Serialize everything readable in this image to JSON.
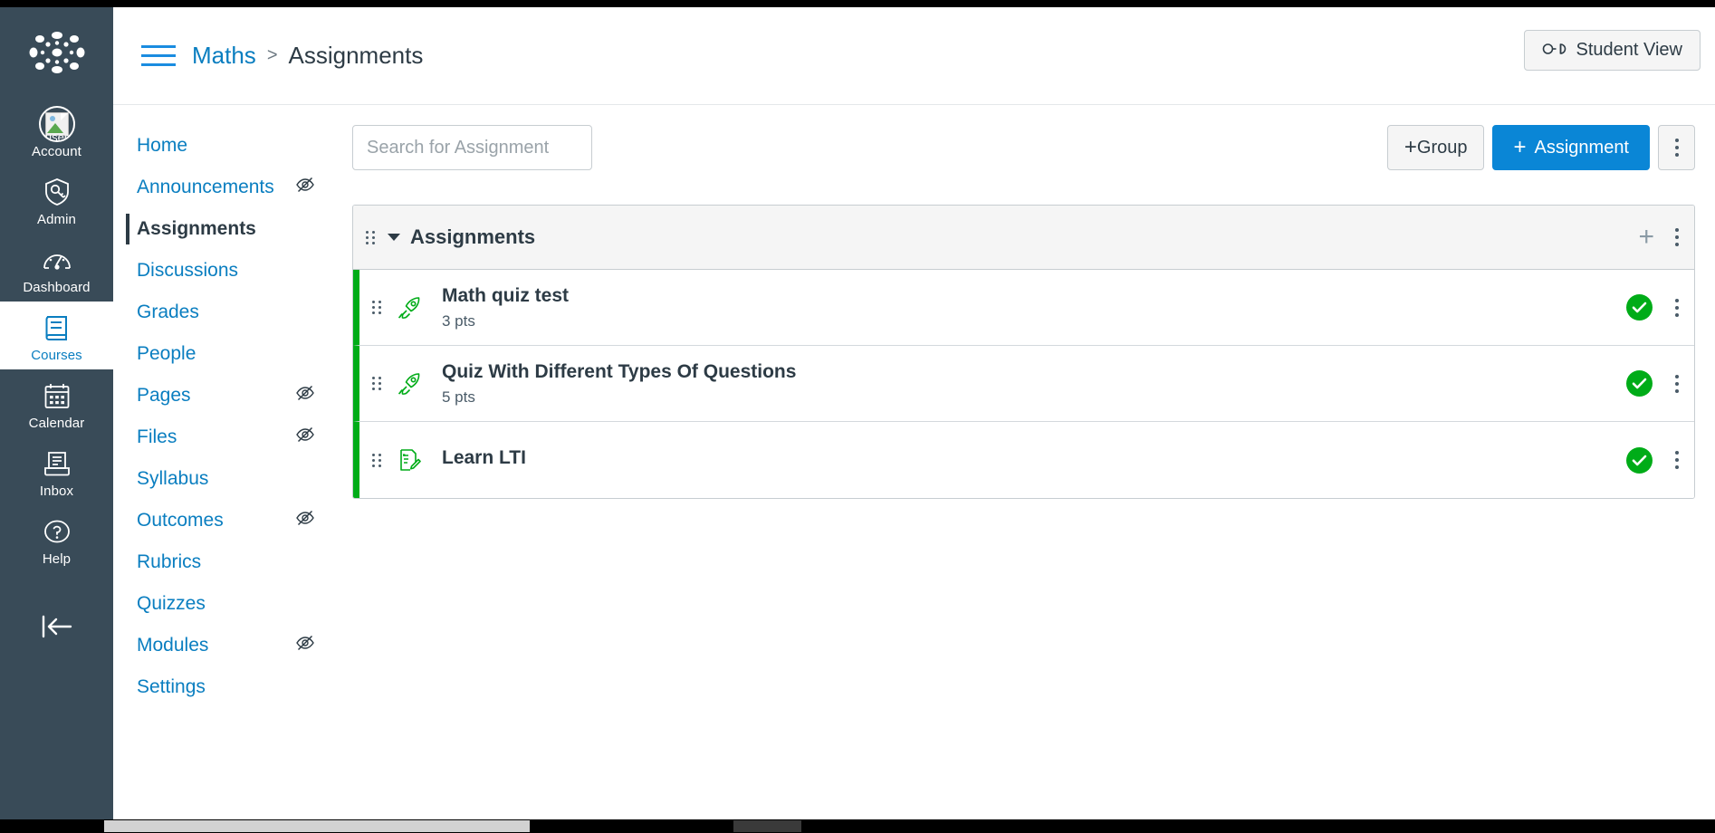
{
  "app": {
    "logo_name": "canvas-logo"
  },
  "global_nav": {
    "items": [
      {
        "label": "Account",
        "icon": "user-avatar-icon",
        "active": false
      },
      {
        "label": "Admin",
        "icon": "shield-key-icon",
        "active": false
      },
      {
        "label": "Dashboard",
        "icon": "speedometer-icon",
        "active": false
      },
      {
        "label": "Courses",
        "icon": "book-icon",
        "active": true
      },
      {
        "label": "Calendar",
        "icon": "calendar-icon",
        "active": false
      },
      {
        "label": "Inbox",
        "icon": "inbox-tray-icon",
        "active": false
      },
      {
        "label": "Help",
        "icon": "question-circle-icon",
        "active": false
      }
    ],
    "avatar_alt": "user",
    "collapse_label": "minimize-nav-icon"
  },
  "header": {
    "menu_icon": "hamburger-menu-icon",
    "breadcrumb": {
      "course": "Maths",
      "separator": ">",
      "current": "Assignments"
    },
    "student_view_label": "Student View",
    "student_view_icon": "eyeglasses-icon"
  },
  "course_nav": {
    "items": [
      {
        "label": "Home",
        "active": false,
        "hidden_from_students": false
      },
      {
        "label": "Announcements",
        "active": false,
        "hidden_from_students": true
      },
      {
        "label": "Assignments",
        "active": true,
        "hidden_from_students": false
      },
      {
        "label": "Discussions",
        "active": false,
        "hidden_from_students": false
      },
      {
        "label": "Grades",
        "active": false,
        "hidden_from_students": false
      },
      {
        "label": "People",
        "active": false,
        "hidden_from_students": false
      },
      {
        "label": "Pages",
        "active": false,
        "hidden_from_students": true
      },
      {
        "label": "Files",
        "active": false,
        "hidden_from_students": true
      },
      {
        "label": "Syllabus",
        "active": false,
        "hidden_from_students": false
      },
      {
        "label": "Outcomes",
        "active": false,
        "hidden_from_students": true
      },
      {
        "label": "Rubrics",
        "active": false,
        "hidden_from_students": false
      },
      {
        "label": "Quizzes",
        "active": false,
        "hidden_from_students": false
      },
      {
        "label": "Modules",
        "active": false,
        "hidden_from_students": true
      },
      {
        "label": "Settings",
        "active": false,
        "hidden_from_students": false
      }
    ]
  },
  "toolbar": {
    "search_placeholder": "Search for Assignment",
    "search_value": "",
    "group_label": "Group",
    "assignment_label": "Assignment",
    "plus": "+",
    "more_options_icon": "kebab-menu-icon"
  },
  "assignment_group": {
    "title": "Assignments",
    "collapse_icon": "caret-down-icon",
    "drag_icon": "drag-handle-icon",
    "add_icon": "plus-icon",
    "menu_icon": "kebab-menu-icon",
    "rows": [
      {
        "title": "Math quiz test",
        "points": "3 pts",
        "type_icon": "rocket-icon",
        "published": true,
        "publish_icon": "check-circle-icon",
        "menu_icon": "kebab-menu-icon"
      },
      {
        "title": "Quiz With Different Types Of Questions",
        "points": "5 pts",
        "type_icon": "rocket-icon",
        "published": true,
        "publish_icon": "check-circle-icon",
        "menu_icon": "kebab-menu-icon"
      },
      {
        "title": "Learn LTI",
        "points": "",
        "type_icon": "assignment-document-icon",
        "published": true,
        "publish_icon": "check-circle-icon",
        "menu_icon": "kebab-menu-icon"
      }
    ]
  },
  "colors": {
    "nav_background": "#394B58",
    "brand_blue": "#0a7ec0",
    "primary_button": "#0a86d6",
    "published_green": "#00AC18",
    "text_dark": "#2d3b45"
  }
}
